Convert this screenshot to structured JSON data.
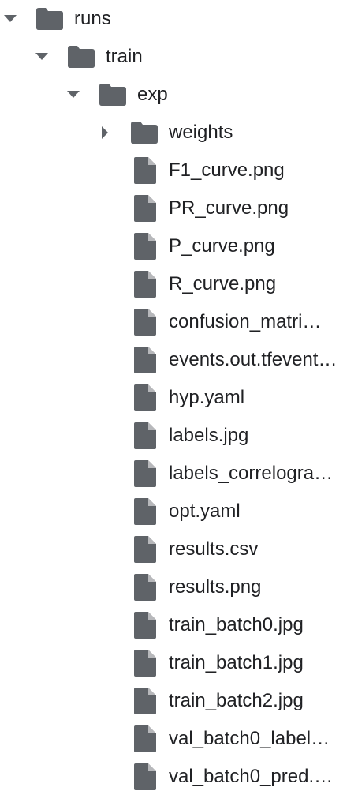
{
  "tree": {
    "runs": {
      "label": "runs",
      "icon": "folder-icon",
      "expanded": true
    },
    "train": {
      "label": "train",
      "icon": "folder-icon",
      "expanded": true
    },
    "exp": {
      "label": "exp",
      "icon": "folder-icon",
      "expanded": true
    },
    "weights": {
      "label": "weights",
      "icon": "folder-icon",
      "expanded": false
    },
    "files": [
      {
        "label": "F1_curve.png",
        "icon": "file-icon"
      },
      {
        "label": "PR_curve.png",
        "icon": "file-icon"
      },
      {
        "label": "P_curve.png",
        "icon": "file-icon"
      },
      {
        "label": "R_curve.png",
        "icon": "file-icon"
      },
      {
        "label": "confusion_matri…",
        "icon": "file-icon"
      },
      {
        "label": "events.out.tfevent…",
        "icon": "file-icon"
      },
      {
        "label": "hyp.yaml",
        "icon": "file-icon"
      },
      {
        "label": "labels.jpg",
        "icon": "file-icon"
      },
      {
        "label": "labels_correlogra…",
        "icon": "file-icon"
      },
      {
        "label": "opt.yaml",
        "icon": "file-icon"
      },
      {
        "label": "results.csv",
        "icon": "file-icon"
      },
      {
        "label": "results.png",
        "icon": "file-icon"
      },
      {
        "label": "train_batch0.jpg",
        "icon": "file-icon"
      },
      {
        "label": "train_batch1.jpg",
        "icon": "file-icon"
      },
      {
        "label": "train_batch2.jpg",
        "icon": "file-icon"
      },
      {
        "label": "val_batch0_label…",
        "icon": "file-icon"
      },
      {
        "label": "val_batch0_pred.…",
        "icon": "file-icon"
      }
    ]
  },
  "colors": {
    "icon": "#5f6368",
    "text": "#202124"
  }
}
